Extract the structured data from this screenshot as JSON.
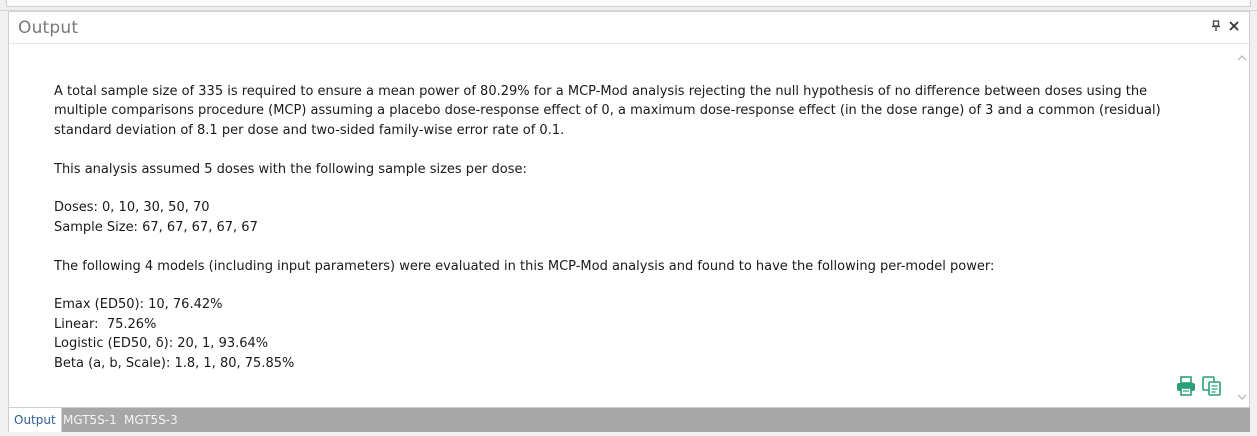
{
  "panel": {
    "title": "Output",
    "pin_icon": "pin-icon",
    "close_icon": "close-icon"
  },
  "report": {
    "summary": "A total sample size of 335 is required to ensure a mean power of 80.29% for a MCP-Mod analysis rejecting the null hypothesis of no difference between doses using the multiple comparisons procedure (MCP) assuming a placebo dose-response effect of 0, a maximum dose-response effect (in the dose range) of 3 and a common (residual) standard deviation of 8.1 per dose and two-sided family-wise error rate of 0.1.",
    "doses_intro": "This analysis assumed 5 doses with the following sample sizes per dose:",
    "doses_line": "Doses: 0, 10, 30, 50, 70",
    "sample_size_line": "Sample Size: 67, 67, 67, 67, 67",
    "models_intro": "The following 4 models (including input parameters) were evaluated in this MCP-Mod analysis and found to have the following per-model power:",
    "models": [
      "Emax (ED50): 10, 76.42%",
      "Linear:  75.26%",
      "Logistic (ED50, δ): 20, 1, 93.64%",
      "Beta (a, b, Scale): 1.8, 1, 80, 75.85%"
    ]
  },
  "actions": {
    "print_icon": "print-icon",
    "copy_icon": "copy-icon",
    "accent_color": "#2aa07a"
  },
  "tabs": [
    {
      "label": "Output",
      "active": true
    },
    {
      "label": "MGT5S-1",
      "active": false
    },
    {
      "label": "MGT5S-3",
      "active": false
    }
  ]
}
